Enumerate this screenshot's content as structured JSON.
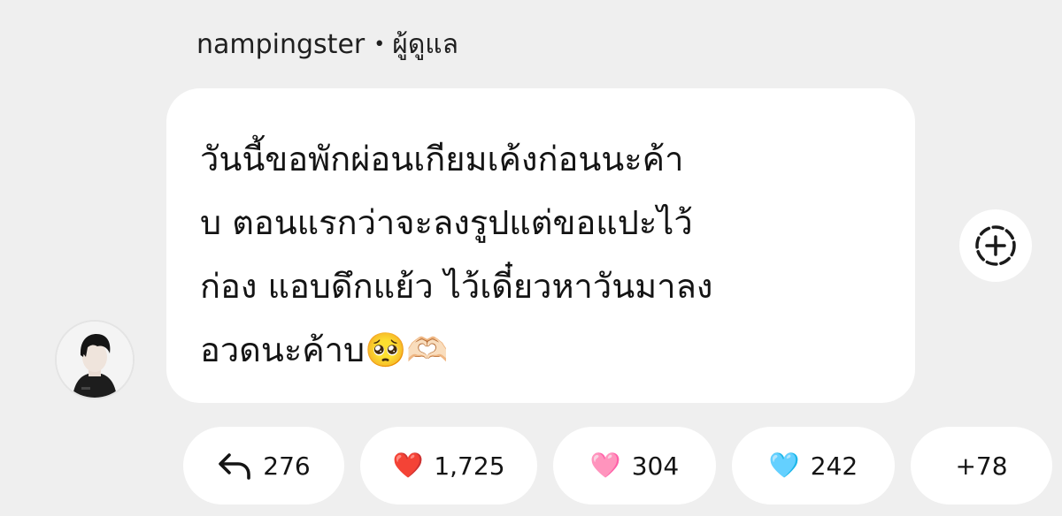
{
  "post": {
    "username": "nampingster",
    "separator": "•",
    "role": "ผู้ดูแล",
    "message": "วันนี้ขอพักผ่อนเกียมเค้งก่อนนะค้า\nบ ตอนแรกว่าจะลงรูปแต่ขอแปะไว้\nก่อง แอบดึกแย้ว ไว้เดี๋ยวหาวันมาลง\nอวดนะค้าบ🥺🫶🏻"
  },
  "reactions": [
    {
      "icon": "reply-arrow-icon",
      "glyph": "",
      "count": "276"
    },
    {
      "icon": "red-heart-icon",
      "glyph": "❤️",
      "count": "1,725",
      "color": "#e0263a"
    },
    {
      "icon": "pink-heart-icon",
      "glyph": "🩷",
      "count": "304",
      "color": "#f4a0c8"
    },
    {
      "icon": "blue-heart-icon",
      "glyph": "🩵",
      "count": "242",
      "color": "#7fd3f0"
    },
    {
      "icon": "",
      "glyph": "",
      "count": "+78"
    }
  ],
  "colors": {
    "background": "#efefef",
    "bubble": "#ffffff",
    "text": "#141414"
  }
}
